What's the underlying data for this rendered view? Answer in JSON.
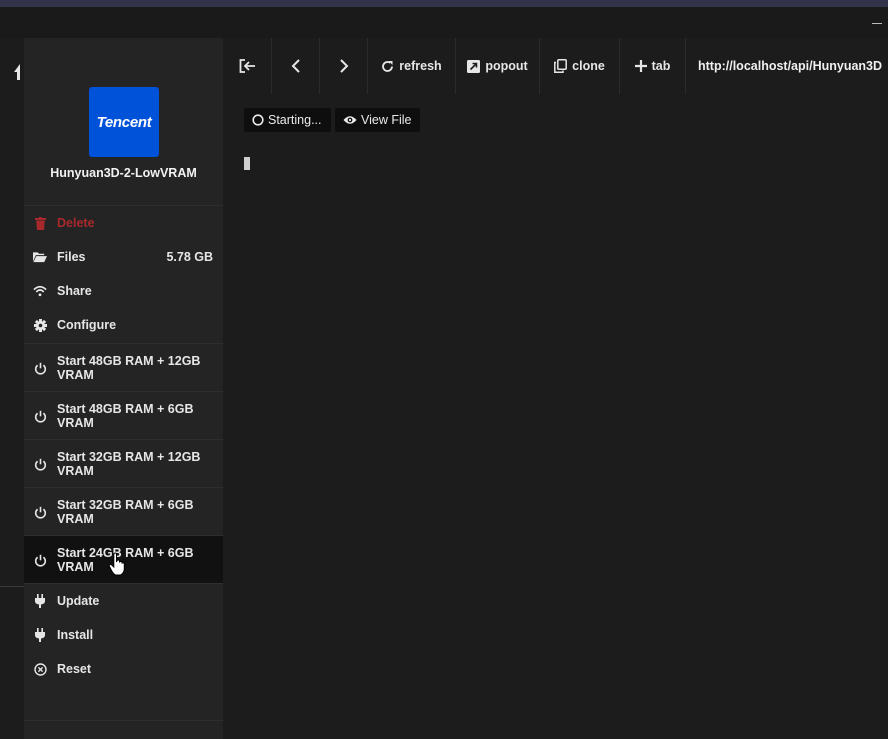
{
  "app": {
    "title": "Hunyuan3D-2-LowVRAM",
    "logo_text": "Tencent",
    "logo_color": "#0052d9"
  },
  "sidebar": {
    "items": [
      {
        "label": "Delete",
        "icon": "trash-icon",
        "style": "danger"
      },
      {
        "label": "Files",
        "icon": "folder-open-icon",
        "value": "5.78 GB"
      },
      {
        "label": "Share",
        "icon": "wifi-icon"
      },
      {
        "label": "Configure",
        "icon": "gear-icon"
      },
      {
        "label": "Start 48GB RAM + 12GB VRAM",
        "icon": "power-icon"
      },
      {
        "label": "Start 48GB RAM + 6GB VRAM",
        "icon": "power-icon"
      },
      {
        "label": "Start 32GB RAM + 12GB VRAM",
        "icon": "power-icon"
      },
      {
        "label": "Start 32GB RAM + 6GB VRAM",
        "icon": "power-icon"
      },
      {
        "label": "Start 24GB RAM + 6GB VRAM",
        "icon": "power-icon",
        "state": "hovered"
      },
      {
        "label": "Update",
        "icon": "plug-icon"
      },
      {
        "label": "Install",
        "icon": "plug-icon"
      },
      {
        "label": "Reset",
        "icon": "circle-x-icon"
      }
    ]
  },
  "toolbar": {
    "exit_icon": "exit-icon",
    "back_icon": "chevron-left-icon",
    "forward_icon": "chevron-right-icon",
    "refresh_label": "refresh",
    "popout_label": "popout",
    "clone_label": "clone",
    "tab_label": "tab",
    "url": "http://localhost/api/Hunyuan3D"
  },
  "main": {
    "status_label": "Starting...",
    "view_file_label": "View File"
  },
  "colors": {
    "danger": "#a8292c",
    "background": "#1c1c1c",
    "sidebar": "#242424"
  }
}
